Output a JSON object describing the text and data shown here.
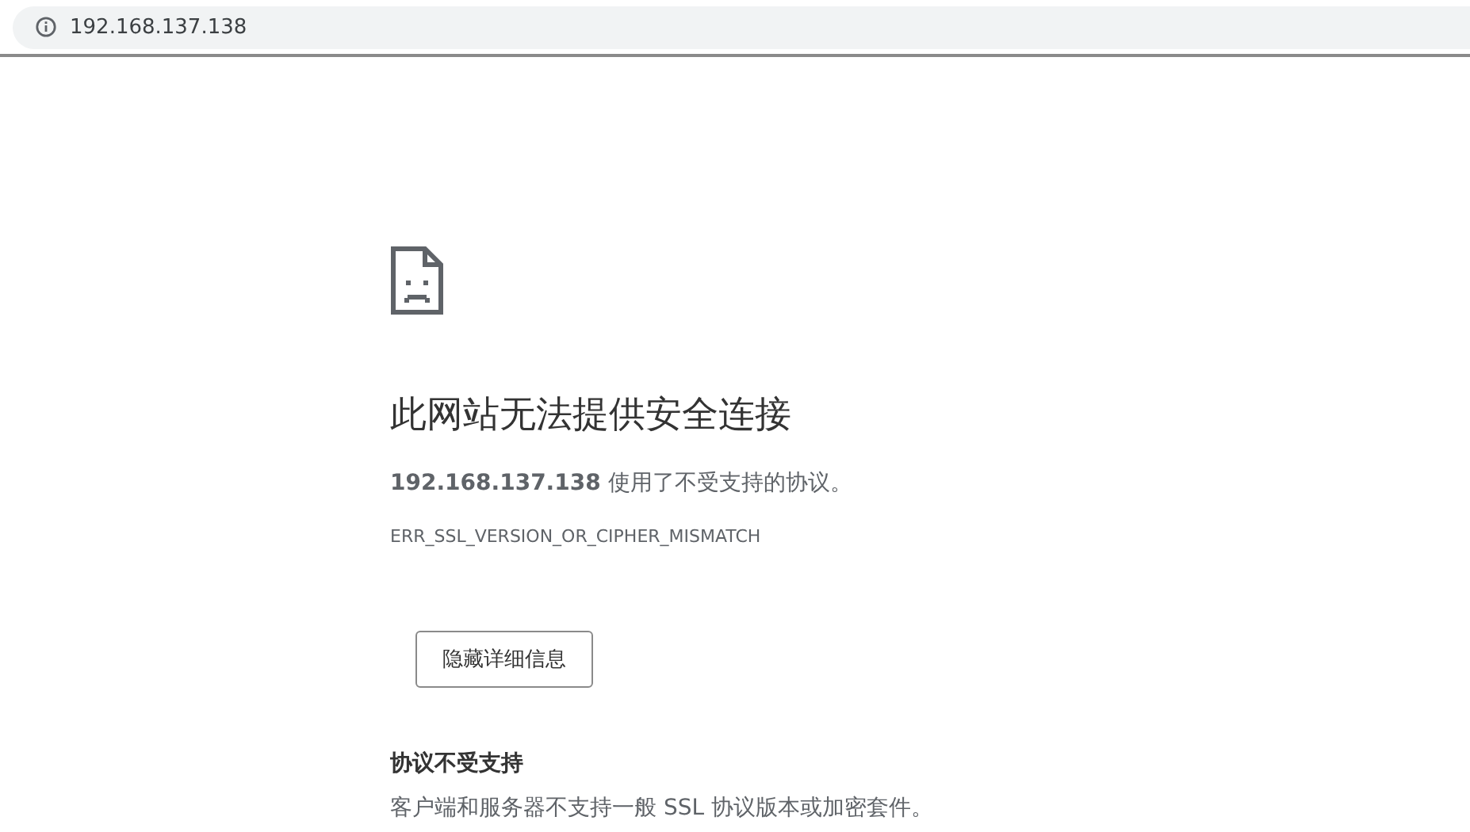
{
  "address_bar": {
    "url": "192.168.137.138"
  },
  "error": {
    "heading": "此网站无法提供安全连接",
    "message": "**192.168.137.138** 使用了不受支持的协议。",
    "code": "ERR_SSL_VERSION_OR_CIPHER_MISMATCH"
  },
  "details_button": {
    "label": "隐藏详细信息"
  },
  "details": {
    "heading": "协议不受支持",
    "text": "客户端和服务器不支持一般 SSL 协议版本或加密套件。"
  }
}
